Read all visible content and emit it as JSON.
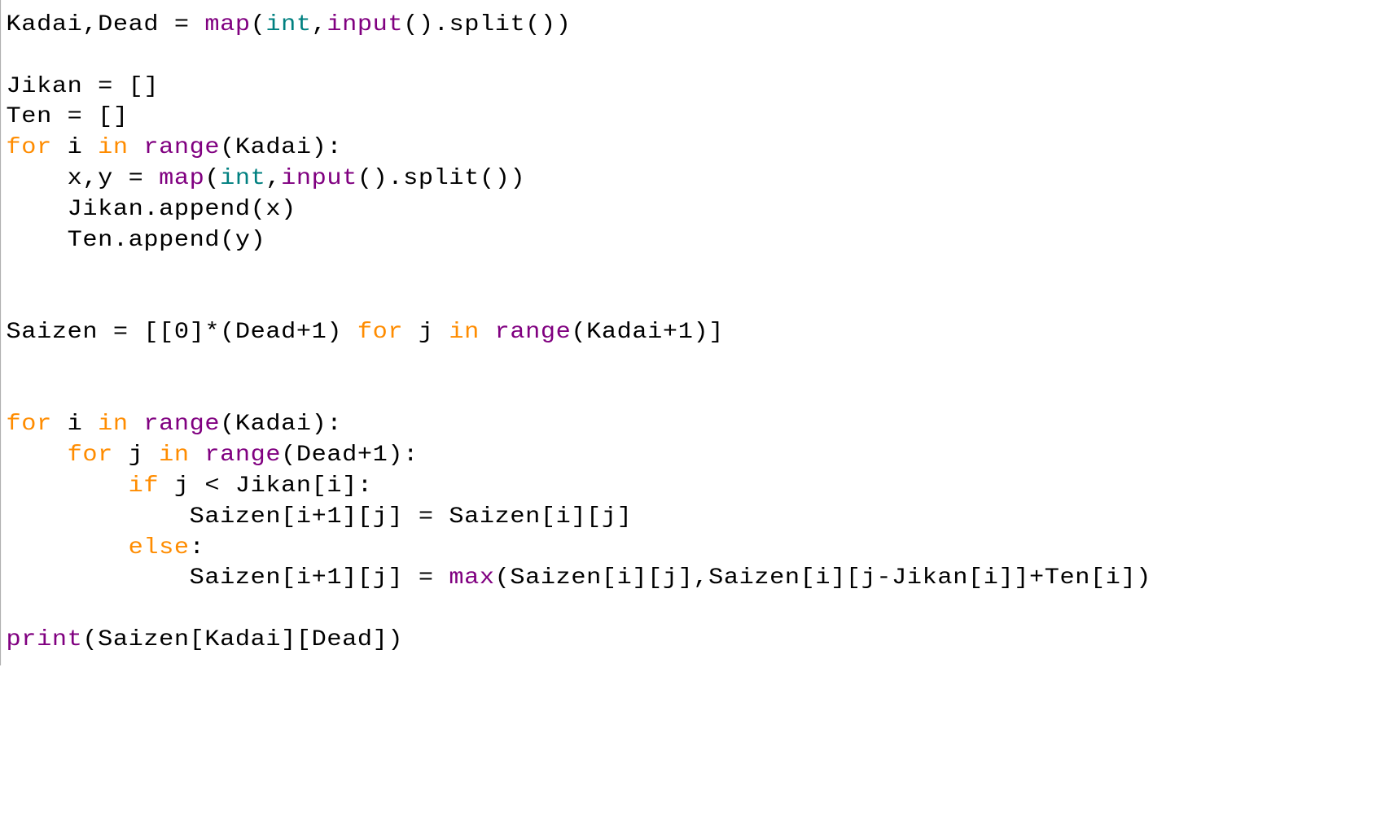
{
  "code": {
    "line1": {
      "kadai": "Kadai",
      "comma": ",",
      "dead": "Dead",
      "eq": " = ",
      "map": "map",
      "lp": "(",
      "int": "int",
      "comma2": ",",
      "input": "input",
      "lp2": "().",
      "split": "split",
      "rp": "())"
    },
    "line3": "Jikan = []",
    "line4": "Ten = []",
    "line5": {
      "for": "for",
      "i": " i ",
      "in": "in",
      "sp": " ",
      "range": "range",
      "args": "(Kadai):"
    },
    "line6": {
      "indent": "    x,y = ",
      "map": "map",
      "lp": "(",
      "int": "int",
      "comma": ",",
      "input": "input",
      "lp2": "().",
      "split": "split",
      "rp": "())"
    },
    "line7": "    Jikan.append(x)",
    "line8": "    Ten.append(y)",
    "line11": {
      "prefix": "Saizen = [[0]*(Dead+1) ",
      "for": "for",
      "j": " j ",
      "in": "in",
      "sp": " ",
      "range": "range",
      "args": "(Kadai+1)]"
    },
    "line14": {
      "for": "for",
      "i": " i ",
      "in": "in",
      "sp": " ",
      "range": "range",
      "args": "(Kadai):"
    },
    "line15": {
      "indent": "    ",
      "for": "for",
      "j": " j ",
      "in": "in",
      "sp": " ",
      "range": "range",
      "args": "(Dead+1):"
    },
    "line16": {
      "indent": "        ",
      "if": "if",
      "cond": " j < Jikan[i]:"
    },
    "line17": "            Saizen[i+1][j] = Saizen[i][j]",
    "line18": {
      "indent": "        ",
      "else": "else",
      "colon": ":"
    },
    "line19": {
      "indent": "            Saizen[i+1][j] = ",
      "max": "max",
      "args": "(Saizen[i][j],Saizen[i][j-Jikan[i]]+Ten[i])"
    },
    "line21": {
      "print": "print",
      "args": "(Saizen[Kadai][Dead])"
    }
  }
}
